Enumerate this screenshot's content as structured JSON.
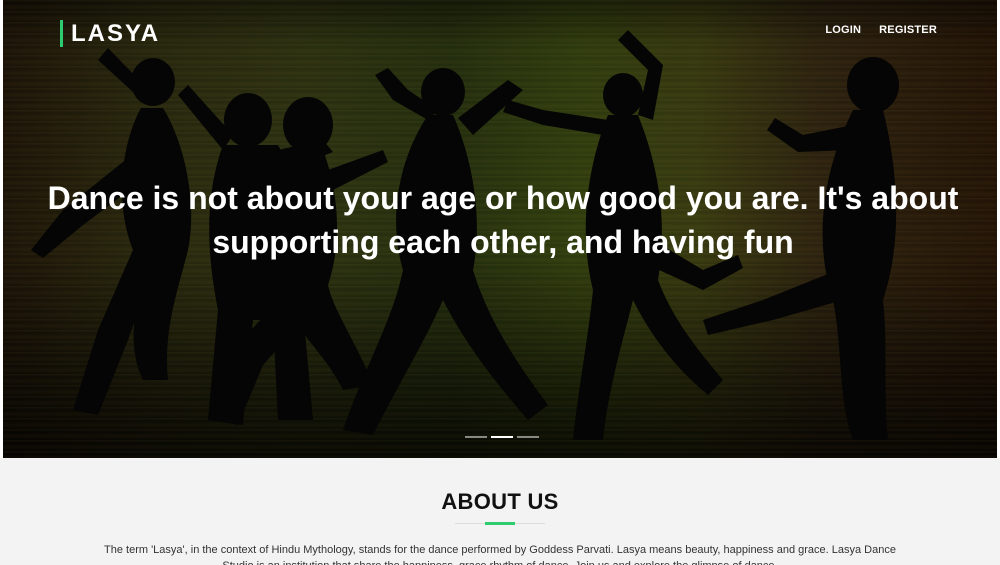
{
  "brand": {
    "name": "LASYA"
  },
  "nav": {
    "login": "LOGIN",
    "register": "REGISTER"
  },
  "hero": {
    "quote": "Dance is not about your age or how good you are. It's about supporting each other, and having fun",
    "slides": 3,
    "active_slide": 2
  },
  "about": {
    "title": "ABOUT US",
    "text": "The term 'Lasya', in the context of Hindu Mythology, stands for the dance performed by Goddess Parvati. Lasya means beauty, happiness and grace. Lasya Dance Studio is an institution that share the happiness, grace rhythm of dance. Join us and explore the glimpse of dance."
  },
  "colors": {
    "accent": "#2ecc71",
    "hero_text": "#ffffff",
    "about_bg": "#f3f3f3"
  }
}
